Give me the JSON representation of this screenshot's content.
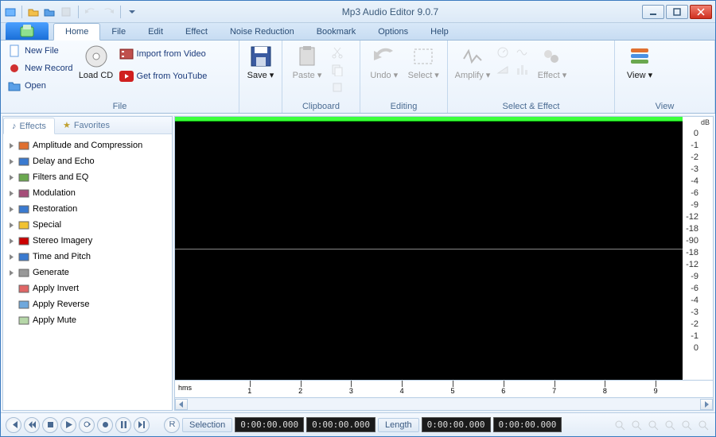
{
  "title": "Mp3 Audio Editor 9.0.7",
  "tabs": [
    "Home",
    "File",
    "Edit",
    "Effect",
    "Noise Reduction",
    "Bookmark",
    "Options",
    "Help"
  ],
  "activeTab": 0,
  "ribbon": {
    "file": {
      "label": "File",
      "new_file": "New File",
      "new_record": "New Record",
      "open": "Open",
      "load_cd": "Load CD",
      "import_video": "Import from Video",
      "get_youtube": "Get from YouTube"
    },
    "save": {
      "label": "Save"
    },
    "clipboard": {
      "label": "Clipboard",
      "paste": "Paste"
    },
    "editing": {
      "label": "Editing",
      "undo": "Undo",
      "select": "Select"
    },
    "selecteffect": {
      "label": "Select & Effect",
      "amplify": "Amplify",
      "effect": "Effect"
    },
    "view": {
      "label": "View",
      "view": "View"
    }
  },
  "sidetabs": {
    "effects": "Effects",
    "favorites": "Favorites"
  },
  "tree": [
    {
      "label": "Amplitude and Compression",
      "expandable": true,
      "color": "#e07030"
    },
    {
      "label": "Delay and Echo",
      "expandable": true,
      "color": "#3a7ad0"
    },
    {
      "label": "Filters and EQ",
      "expandable": true,
      "color": "#6aa84f"
    },
    {
      "label": "Modulation",
      "expandable": true,
      "color": "#a64d79"
    },
    {
      "label": "Restoration",
      "expandable": true,
      "color": "#3a7ad0"
    },
    {
      "label": "Special",
      "expandable": true,
      "color": "#f1c232"
    },
    {
      "label": "Stereo Imagery",
      "expandable": true,
      "color": "#cc0000"
    },
    {
      "label": "Time and Pitch",
      "expandable": true,
      "color": "#3a7ad0"
    },
    {
      "label": "Generate",
      "expandable": true,
      "color": "#999999"
    },
    {
      "label": "Apply Invert",
      "expandable": false,
      "color": "#e06666"
    },
    {
      "label": "Apply Reverse",
      "expandable": false,
      "color": "#6fa8dc"
    },
    {
      "label": "Apply Mute",
      "expandable": false,
      "color": "#b6d7a8"
    }
  ],
  "dbscale_label": "dB",
  "dbscale": [
    "0",
    "-1",
    "-2",
    "-3",
    "-4",
    "-6",
    "-9",
    "-12",
    "-18",
    "-90",
    "-18",
    "-12",
    "-9",
    "-6",
    "-4",
    "-3",
    "-2",
    "-1",
    "0"
  ],
  "timeruler": {
    "unit": "hms",
    "ticks": [
      1,
      2,
      3,
      4,
      5,
      6,
      7,
      8,
      9
    ]
  },
  "status": {
    "selection_label": "Selection",
    "length_label": "Length",
    "sel_start": "0:00:00.000",
    "sel_end": "0:00:00.000",
    "len_start": "0:00:00.000",
    "len_end": "0:00:00.000"
  }
}
